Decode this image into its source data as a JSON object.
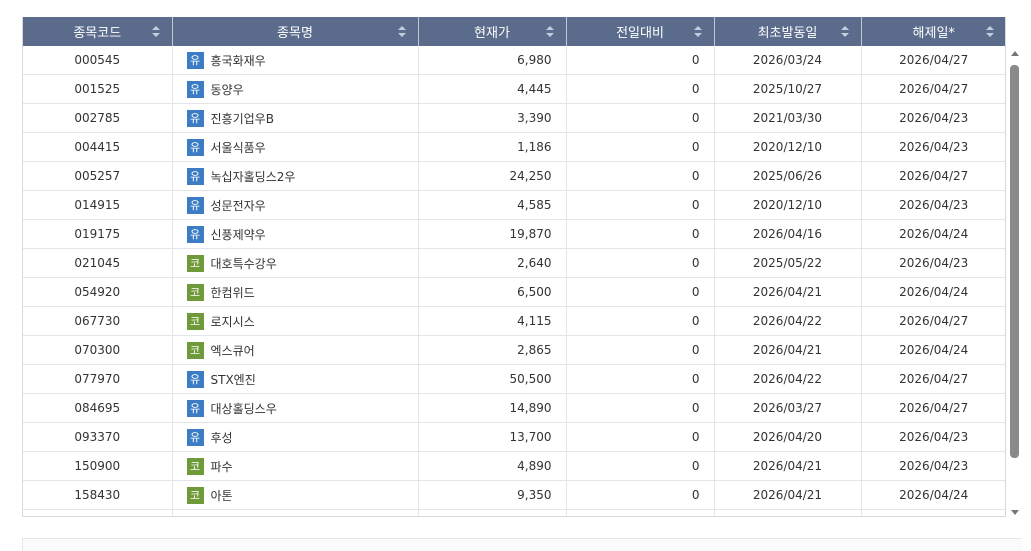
{
  "columns": [
    {
      "label": "종목코드"
    },
    {
      "label": "종목명"
    },
    {
      "label": "현재가"
    },
    {
      "label": "전일대비"
    },
    {
      "label": "최초발동일"
    },
    {
      "label": "해제일*"
    }
  ],
  "rows": [
    {
      "code": "000545",
      "market": "유",
      "name": "흥국화재우",
      "price": "6,980",
      "change": "0",
      "first_date": "2026/03/24",
      "release_date": "2026/04/27"
    },
    {
      "code": "001525",
      "market": "유",
      "name": "동양우",
      "price": "4,445",
      "change": "0",
      "first_date": "2025/10/27",
      "release_date": "2026/04/27"
    },
    {
      "code": "002785",
      "market": "유",
      "name": "진흥기업우B",
      "price": "3,390",
      "change": "0",
      "first_date": "2021/03/30",
      "release_date": "2026/04/23"
    },
    {
      "code": "004415",
      "market": "유",
      "name": "서울식품우",
      "price": "1,186",
      "change": "0",
      "first_date": "2020/12/10",
      "release_date": "2026/04/23"
    },
    {
      "code": "005257",
      "market": "유",
      "name": "녹십자홀딩스2우",
      "price": "24,250",
      "change": "0",
      "first_date": "2025/06/26",
      "release_date": "2026/04/27"
    },
    {
      "code": "014915",
      "market": "유",
      "name": "성문전자우",
      "price": "4,585",
      "change": "0",
      "first_date": "2020/12/10",
      "release_date": "2026/04/23"
    },
    {
      "code": "019175",
      "market": "유",
      "name": "신풍제약우",
      "price": "19,870",
      "change": "0",
      "first_date": "2026/04/16",
      "release_date": "2026/04/24"
    },
    {
      "code": "021045",
      "market": "코",
      "name": "대호특수강우",
      "price": "2,640",
      "change": "0",
      "first_date": "2025/05/22",
      "release_date": "2026/04/23"
    },
    {
      "code": "054920",
      "market": "코",
      "name": "한컴위드",
      "price": "6,500",
      "change": "0",
      "first_date": "2026/04/21",
      "release_date": "2026/04/24"
    },
    {
      "code": "067730",
      "market": "코",
      "name": "로지시스",
      "price": "4,115",
      "change": "0",
      "first_date": "2026/04/22",
      "release_date": "2026/04/27"
    },
    {
      "code": "070300",
      "market": "코",
      "name": "엑스큐어",
      "price": "2,865",
      "change": "0",
      "first_date": "2026/04/21",
      "release_date": "2026/04/24"
    },
    {
      "code": "077970",
      "market": "유",
      "name": "STX엔진",
      "price": "50,500",
      "change": "0",
      "first_date": "2026/04/22",
      "release_date": "2026/04/27"
    },
    {
      "code": "084695",
      "market": "유",
      "name": "대상홀딩스우",
      "price": "14,890",
      "change": "0",
      "first_date": "2026/03/27",
      "release_date": "2026/04/27"
    },
    {
      "code": "093370",
      "market": "유",
      "name": "후성",
      "price": "13,700",
      "change": "0",
      "first_date": "2026/04/20",
      "release_date": "2026/04/23"
    },
    {
      "code": "150900",
      "market": "코",
      "name": "파수",
      "price": "4,890",
      "change": "0",
      "first_date": "2026/04/21",
      "release_date": "2026/04/23"
    },
    {
      "code": "158430",
      "market": "코",
      "name": "아톤",
      "price": "9,350",
      "change": "0",
      "first_date": "2026/04/21",
      "release_date": "2026/04/24"
    },
    {
      "code": "",
      "market": "",
      "name": "",
      "price": "",
      "change": "",
      "first_date": "",
      "release_date": ""
    }
  ],
  "colors": {
    "header_bg": "#5b6b8c",
    "market_yu": "#3b7cc4",
    "market_ko": "#6f9a3a"
  },
  "icons": {
    "sort": "sort-updown-icon",
    "scroll_up": "arrow-up-icon",
    "scroll_down": "arrow-down-icon"
  }
}
